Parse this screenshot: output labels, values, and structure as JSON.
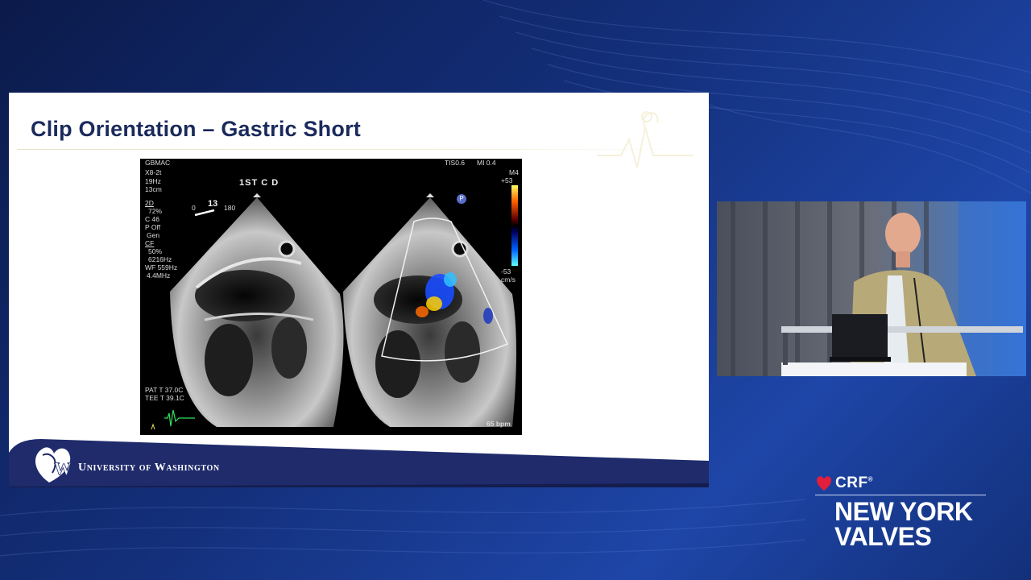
{
  "slide": {
    "title": "Clip Orientation – Gastric Short",
    "institution": "University of Washington"
  },
  "echo": {
    "top_left": {
      "site": "GBMAC",
      "probe": "X8-2t",
      "frame_rate": "19Hz",
      "depth": "13cm",
      "mode_2d": "2D",
      "gain_2d": "72%",
      "c_value": "C 46",
      "p_value": "P Off",
      "gen": "Gen",
      "mode_cf": "CF",
      "gain_cf": "50%",
      "cf_freq": "6216Hz",
      "wf": "WF 559Hz",
      "mhz": "4.4MHz"
    },
    "angle": {
      "start": "0",
      "value": "13",
      "end": "180"
    },
    "header_label": "1ST C D",
    "tis": "TIS0.6",
    "mi": "MI 0.4",
    "scale_mode": "M4",
    "scale_top": "+53",
    "scale_bottom": "-53",
    "scale_unit": "cm/s",
    "pat_t": "PAT T 37.0C",
    "tee_t": "TEE T 39.1C",
    "heart_rate": "65 bpm",
    "probe_badge": "P"
  },
  "branding": {
    "org": "CRF",
    "reg": "®",
    "event_line1": "NEW YORK",
    "event_line2": "VALVES"
  },
  "colors": {
    "title": "#1b2a5c",
    "banner": "#1f2b6b",
    "background": "#14307c"
  }
}
